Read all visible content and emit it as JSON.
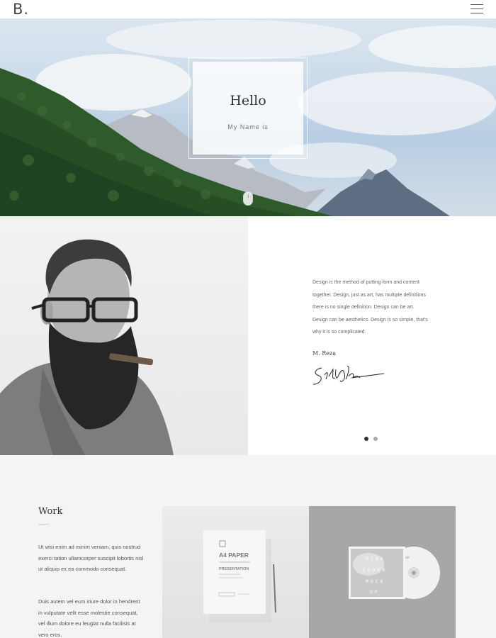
{
  "header": {
    "logo": "B.",
    "menu_icon": "hamburger-icon"
  },
  "hero": {
    "title": "Hello",
    "subtitle": "My Name is",
    "scroll_icon": "mouse-scroll-icon"
  },
  "about": {
    "text_lines": [
      "Design is the method of putting form and content",
      "together. Design, just as art, has multiple definitions",
      "there is no single definition. Design can be art.",
      "Design can be aesthetics. Design is so simple, that's",
      "why it is so complicated."
    ],
    "name": "M. Reza",
    "signature_icon": "signature-image",
    "slider": {
      "count": 2,
      "active_index": 0,
      "active_color": "#333333",
      "inactive_color": "#aaaaaa"
    }
  },
  "work": {
    "title": "Work",
    "paragraph1": "Ut wisi enim ad minim veniam, quis nostrud exerci tation ullamcorper suscipit lobortis nisl ut aliquip ex ea commodo consequat.",
    "paragraph2": "Duis autem vel eum iriure dolor in hendrerit in vulputate velit esse molestie consequat, vel illum dolore eu feugiat nulla facilisis at vero eros.",
    "items": [
      {
        "kind": "a4-paper-mockup",
        "label_top": "A4 PAPER",
        "label_mid": "PRESENTATION"
      },
      {
        "kind": "disk-cover-mockup",
        "cover_lines": [
          "DISK",
          "COVER",
          "MOCK",
          "UP"
        ],
        "disc_label": "DISK"
      }
    ]
  }
}
